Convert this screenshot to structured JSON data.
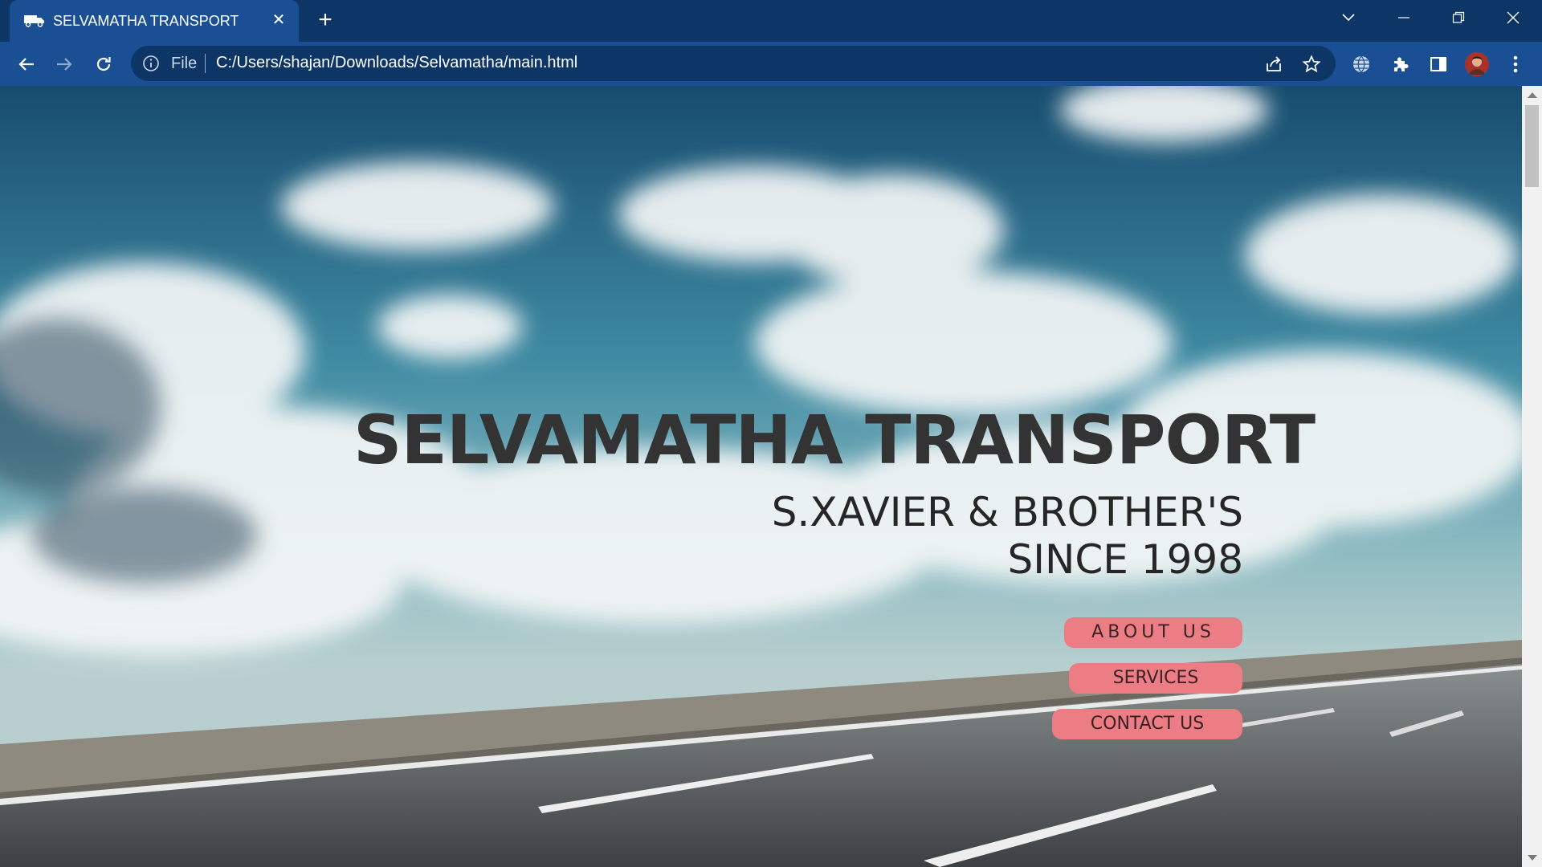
{
  "browser": {
    "tab": {
      "title": "SELVAMATHA TRANSPORT",
      "favicon": "truck-icon"
    },
    "new_tab_label": "+",
    "address": {
      "scheme": "File",
      "url": "C:/Users/shajan/Downloads/Selvamatha/main.html"
    },
    "colors": {
      "frame": "#0d3566",
      "toolbar": "#1a4f94"
    }
  },
  "page": {
    "title": "SELVAMATHA TRANSPORT",
    "subtitle_line1": "S.XAVIER & BROTHER'S",
    "subtitle_line2": "SINCE 1998",
    "buttons": {
      "about": "ABOUT US",
      "services": "SERVICES",
      "contact": "CONTACT US"
    },
    "colors": {
      "button": "#ec7d84",
      "title": "#333333"
    }
  }
}
